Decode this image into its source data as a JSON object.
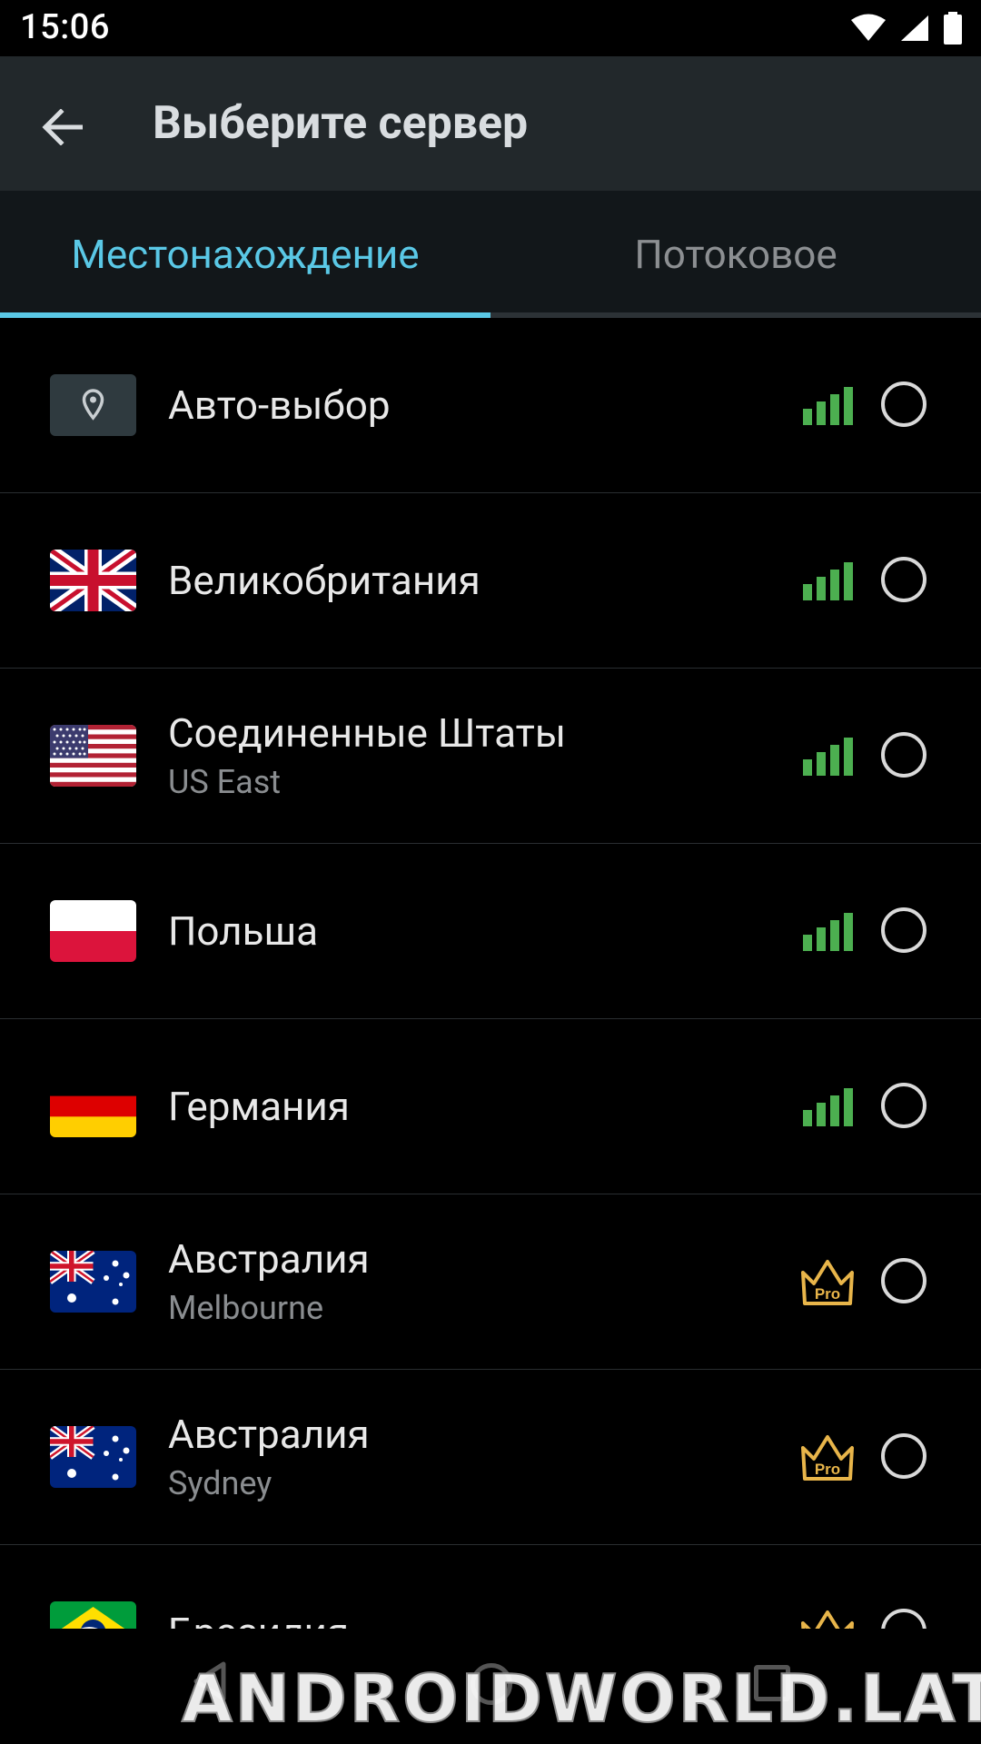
{
  "status_bar": {
    "time": "15:06"
  },
  "app_bar": {
    "title": "Выберите сервер",
    "back_icon": "arrow-back-icon"
  },
  "tabs": [
    {
      "label": "Местонахождение",
      "selected": true
    },
    {
      "label": "Потоковое",
      "selected": false
    }
  ],
  "colors": {
    "accent": "#5ac8e6",
    "signal": "#4caf50",
    "pro": "#e8b54a",
    "appbar": "#22282b"
  },
  "servers": [
    {
      "name": "Авто-выбор",
      "sub": "",
      "icon": "location-pin-icon",
      "badge": "signal",
      "selected": false
    },
    {
      "name": "Великобритания",
      "sub": "",
      "icon": "uk-flag-icon",
      "badge": "signal",
      "selected": false
    },
    {
      "name": "Соединенные Штаты",
      "sub": "US East",
      "icon": "us-flag-icon",
      "badge": "signal",
      "selected": false
    },
    {
      "name": "Польша",
      "sub": "",
      "icon": "poland-flag-icon",
      "badge": "signal",
      "selected": false
    },
    {
      "name": "Германия",
      "sub": "",
      "icon": "germany-flag-icon",
      "badge": "signal",
      "selected": false
    },
    {
      "name": "Австралия",
      "sub": "Melbourne",
      "icon": "australia-flag-icon",
      "badge": "pro",
      "selected": false
    },
    {
      "name": "Австралия",
      "sub": "Sydney",
      "icon": "australia-flag-icon",
      "badge": "pro",
      "selected": false
    },
    {
      "name": "Бразилия",
      "sub": "",
      "icon": "brazil-flag-icon",
      "badge": "pro",
      "selected": false
    }
  ],
  "pro_label": "Pro",
  "watermark": "ANDROIDWORLD.LAT"
}
